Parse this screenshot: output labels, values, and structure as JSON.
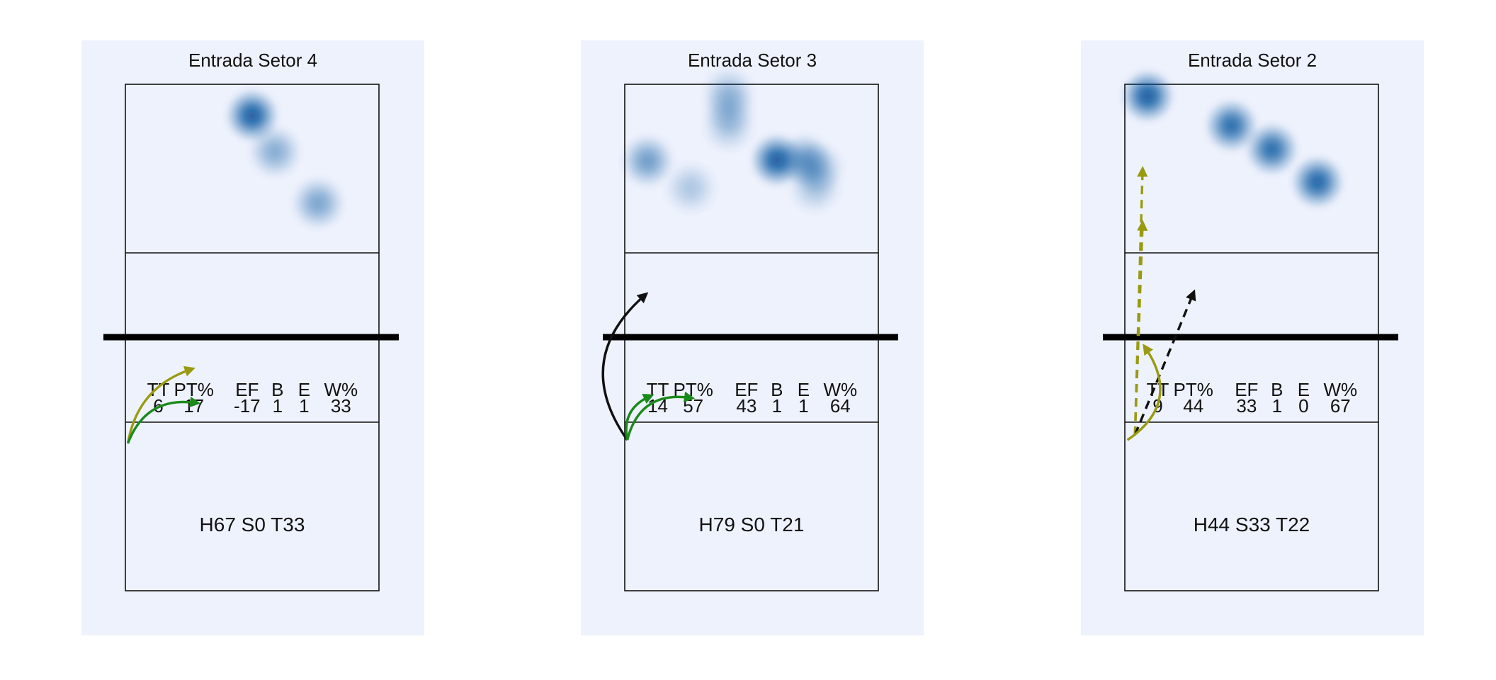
{
  "colors": {
    "panel_bg": "#eef2fd",
    "court_line": "#111111",
    "net": "#000000",
    "heat": "#08519c",
    "arrow_green": "#1a8a1a",
    "arrow_olive": "#9a9a10",
    "arrow_black": "#111111"
  },
  "stats_headers": [
    "TT",
    "PT%",
    "EF",
    "B",
    "E",
    "W%"
  ],
  "chart_data": [
    {
      "type": "heatmap",
      "title": "Entrada Setor 4",
      "stats": [
        "6",
        "17",
        "-17",
        "1",
        "1",
        "33"
      ],
      "footer": "H67 S0 T33",
      "hotspots": [
        {
          "x": 0.5,
          "y": 0.37,
          "intensity": 0.95
        },
        {
          "x": 0.59,
          "y": 0.8,
          "intensity": 0.45
        },
        {
          "x": 0.76,
          "y": 1.41,
          "intensity": 0.5
        }
      ],
      "arrows": [
        {
          "from": [
            0.01,
            2.13
          ],
          "to": [
            0.26,
            1.69
          ],
          "color": "arrow_olive",
          "dashed": false,
          "curve": 0.3
        },
        {
          "from": [
            0.01,
            2.13
          ],
          "to": [
            0.28,
            1.89
          ],
          "color": "arrow_green",
          "dashed": false,
          "curve": 0.4
        }
      ]
    },
    {
      "type": "heatmap",
      "title": "Entrada Setor 3",
      "stats": [
        "14",
        "57",
        "43",
        "1",
        "1",
        "64"
      ],
      "footer": "H79 S0 T21",
      "hotspots": [
        {
          "x": 0.41,
          "y": 0.1,
          "intensity": 0.32
        },
        {
          "x": 0.41,
          "y": 0.3,
          "intensity": 0.32
        },
        {
          "x": 0.41,
          "y": 0.5,
          "intensity": 0.28
        },
        {
          "x": 0.09,
          "y": 0.91,
          "intensity": 0.55
        },
        {
          "x": 0.6,
          "y": 0.9,
          "intensity": 0.95
        },
        {
          "x": 0.71,
          "y": 0.9,
          "intensity": 0.55
        },
        {
          "x": 0.76,
          "y": 1.0,
          "intensity": 0.4
        },
        {
          "x": 0.75,
          "y": 1.22,
          "intensity": 0.3
        },
        {
          "x": 0.26,
          "y": 1.23,
          "intensity": 0.28
        }
      ],
      "arrows": [
        {
          "from": [
            0.01,
            2.11
          ],
          "to": [
            0.08,
            1.25
          ],
          "color": "arrow_black",
          "dashed": false,
          "curve": 0.45
        },
        {
          "from": [
            0.01,
            2.11
          ],
          "to": [
            0.1,
            1.85
          ],
          "color": "arrow_green",
          "dashed": false,
          "curve": 0.4
        },
        {
          "from": [
            0.01,
            2.11
          ],
          "to": [
            0.26,
            1.86
          ],
          "color": "arrow_green",
          "dashed": false,
          "curve": 0.45
        }
      ]
    },
    {
      "type": "heatmap",
      "title": "Entrada Setor 2",
      "stats": [
        "9",
        "44",
        "33",
        "1",
        "0",
        "67"
      ],
      "footer": "H44 S33 T22",
      "hotspots": [
        {
          "x": 0.09,
          "y": 0.14,
          "intensity": 0.95
        },
        {
          "x": 0.42,
          "y": 0.49,
          "intensity": 0.85
        },
        {
          "x": 0.58,
          "y": 0.77,
          "intensity": 0.85
        },
        {
          "x": 0.76,
          "y": 1.16,
          "intensity": 0.9
        }
      ],
      "arrows": [
        {
          "from": [
            0.04,
            2.08
          ],
          "to": [
            0.07,
            0.51
          ],
          "color": "arrow_olive",
          "dashed": true,
          "curve": 0.0
        },
        {
          "from": [
            0.04,
            2.08
          ],
          "to": [
            0.07,
            0.83
          ],
          "color": "arrow_olive",
          "dashed": true,
          "curve": 0.0
        },
        {
          "from": [
            0.04,
            2.08
          ],
          "to": [
            0.27,
            1.24
          ],
          "color": "arrow_black",
          "dashed": true,
          "curve": 0.0
        },
        {
          "from": [
            0.01,
            2.11
          ],
          "to": [
            0.08,
            1.56
          ],
          "color": "arrow_olive",
          "dashed": false,
          "curve": -0.5
        }
      ]
    }
  ]
}
